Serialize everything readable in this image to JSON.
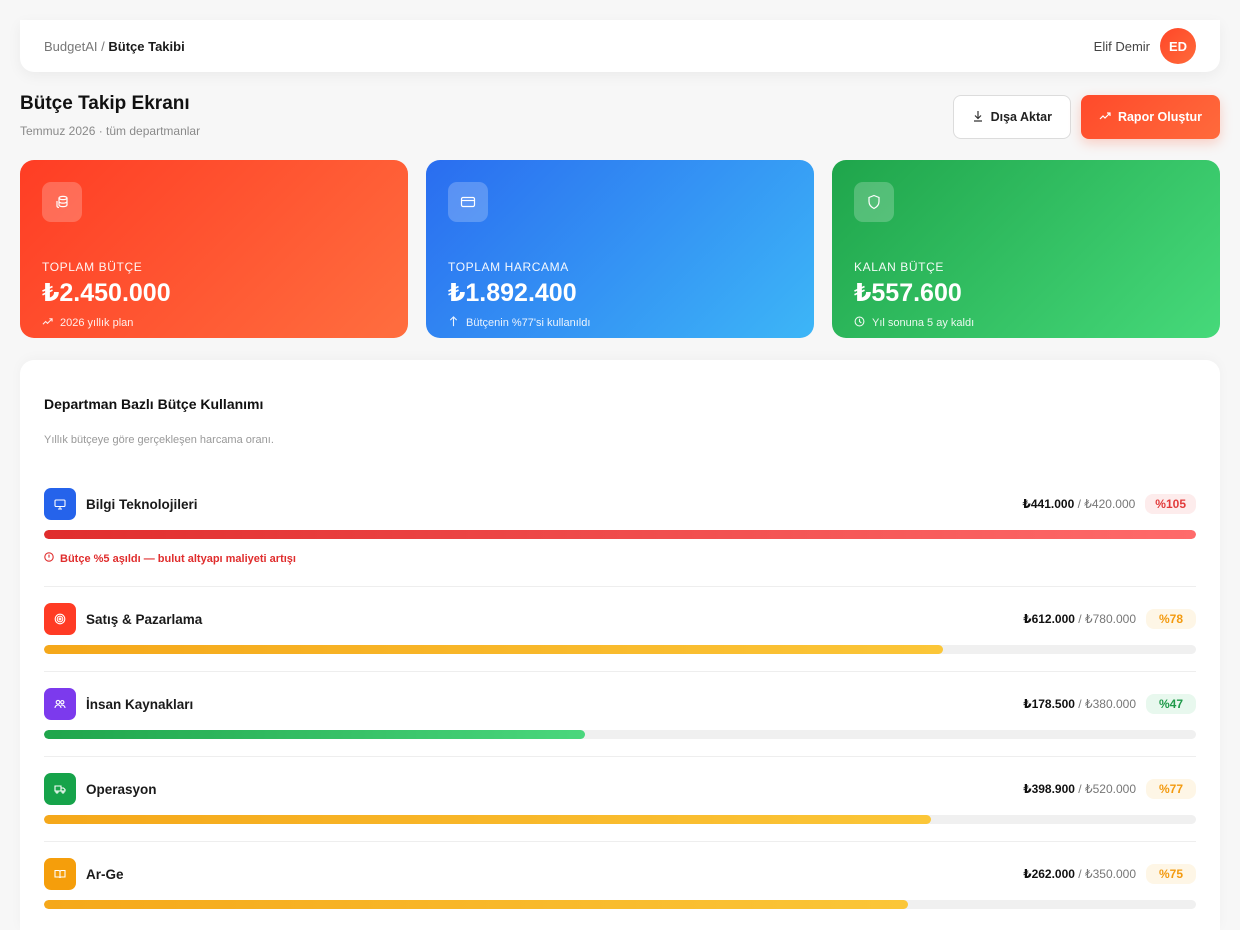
{
  "breadcrumb": {
    "app": "BudgetAI",
    "separator": "/",
    "current": "Bütçe Takibi"
  },
  "user": {
    "name": "Elif Demir",
    "initials": "ED"
  },
  "page": {
    "title": "Bütçe Takip Ekranı",
    "subtitle": "Temmuz 2026 · tüm departmanlar"
  },
  "actions": {
    "export_label": "Dışa Aktar",
    "report_label": "Rapor Oluştur"
  },
  "stats": [
    {
      "label": "TOPLAM BÜTÇE",
      "value": "₺2.450.000",
      "note": "2026 yıllık plan",
      "icon": "coins-icon",
      "note_icon": "trend-icon"
    },
    {
      "label": "TOPLAM HARCAMA",
      "value": "₺1.892.400",
      "note": "Bütçenin %77'si kullanıldı",
      "icon": "card-icon",
      "note_icon": "arrow-up-icon"
    },
    {
      "label": "KALAN BÜTÇE",
      "value": "₺557.600",
      "note": "Yıl sonuna 5 ay kaldı",
      "icon": "shield-icon",
      "note_icon": "clock-icon"
    }
  ],
  "departments_panel": {
    "title": "Departman Bazlı Bütçe Kullanımı",
    "subtitle": "Yıllık bütçeye göre gerçekleşen harcama oranı.",
    "items": [
      {
        "name": "Bilgi Teknolojileri",
        "spent": "₺441.000",
        "sep": "/",
        "budget": "₺420.000",
        "percent_label": "%105",
        "fill": 1.0,
        "status": "red",
        "icon_color": "#2563eb",
        "icon": "monitor-icon",
        "warning": "Bütçe %5 aşıldı — bulut altyapı maliyeti artışı"
      },
      {
        "name": "Satış & Pazarlama",
        "spent": "₺612.000",
        "sep": "/",
        "budget": "₺780.000",
        "percent_label": "%78",
        "fill": 0.78,
        "status": "amber",
        "icon_color": "#ff3b24",
        "icon": "target-icon"
      },
      {
        "name": "İnsan Kaynakları",
        "spent": "₺178.500",
        "sep": "/",
        "budget": "₺380.000",
        "percent_label": "%47",
        "fill": 0.47,
        "status": "green",
        "icon_color": "#7c3aed",
        "icon": "users-icon"
      },
      {
        "name": "Operasyon",
        "spent": "₺398.900",
        "sep": "/",
        "budget": "₺520.000",
        "percent_label": "%77",
        "fill": 0.77,
        "status": "amber",
        "icon_color": "#16a34a",
        "icon": "truck-icon"
      },
      {
        "name": "Ar-Ge",
        "spent": "₺262.000",
        "sep": "/",
        "budget": "₺350.000",
        "percent_label": "%75",
        "fill": 0.75,
        "status": "amber",
        "icon_color": "#f59e0b",
        "icon": "book-icon"
      }
    ]
  }
}
